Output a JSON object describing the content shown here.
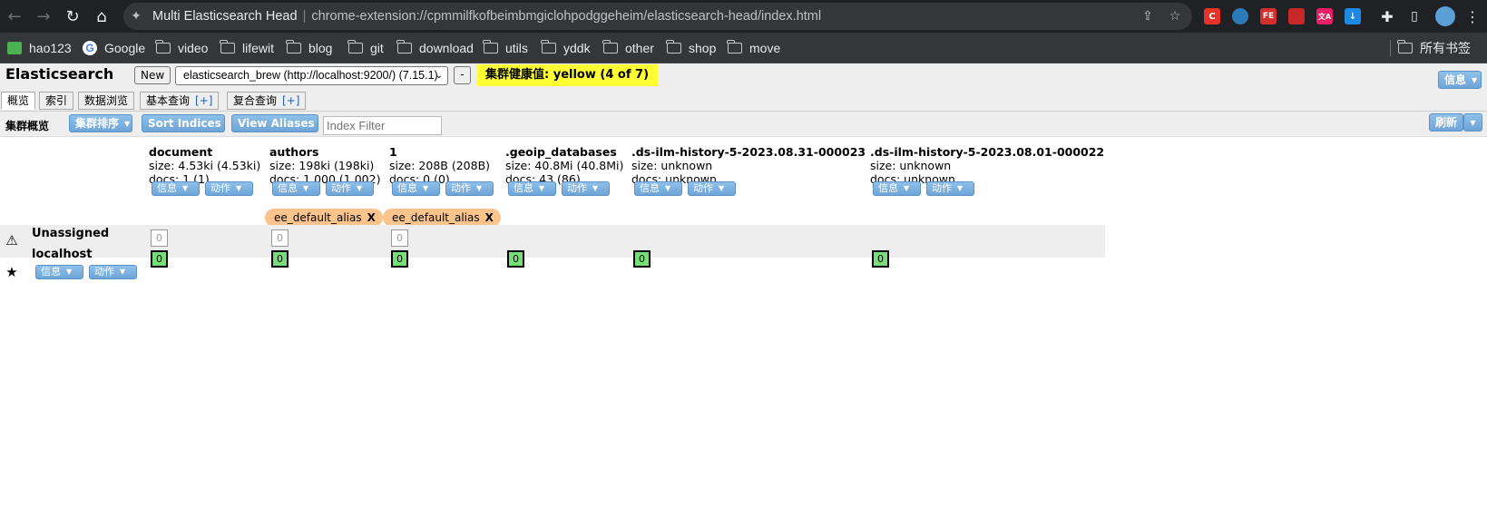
{
  "browser": {
    "tab_title": "Multi Elasticsearch Head",
    "url": "chrome-extension://cpmmilfkofbeimbmgiclohpodggeheim/elasticsearch-head/index.html",
    "extensions": [
      {
        "name": "c-extension-icon",
        "label": "C",
        "color": "#e5332a"
      },
      {
        "name": "globe-extension-icon",
        "label": "●",
        "color": "#2b7bb9"
      },
      {
        "name": "fe-extension-icon",
        "label": "FE",
        "color": "#d32f2f"
      },
      {
        "name": "cube-extension-icon",
        "label": "■",
        "color": "#c62828"
      },
      {
        "name": "translate-extension-icon",
        "label": "文A",
        "color": "#e91e63"
      },
      {
        "name": "download-extension-icon",
        "label": "↓",
        "color": "#1e88e5"
      }
    ]
  },
  "bookmarks": {
    "items": [
      "hao123",
      "Google",
      "video",
      "lifewit",
      "blog",
      "git",
      "download",
      "utils",
      "yddk",
      "other",
      "shop",
      "move"
    ],
    "all_bookmarks": "所有书签"
  },
  "header": {
    "title": "Elasticsearch",
    "new_label": "New",
    "cluster_selected": "elasticsearch_brew (http://localhost:9200/) (7.15.1)",
    "minus_label": "-",
    "health": "集群健康值: yellow (4 of 7)",
    "health_color": "#ffff33",
    "info_label": "信息"
  },
  "tabs": [
    {
      "label": "概览",
      "active": true
    },
    {
      "label": "索引",
      "active": false
    },
    {
      "label": "数据浏览",
      "active": false
    },
    {
      "label": "基本查询",
      "plus": "[+]"
    },
    {
      "label": "复合查询",
      "plus": "[+]"
    }
  ],
  "toolbar": {
    "label": "集群概览",
    "cluster_sort": "集群排序",
    "sort_indices": "Sort Indices",
    "view_aliases": "View Aliases",
    "filter_placeholder": "Index Filter",
    "refresh": "刷新"
  },
  "buttons": {
    "info": "信息",
    "action": "动作"
  },
  "indices": [
    {
      "name": "document",
      "size": "size: 4.53ki (4.53ki)",
      "docs": "docs: 1 (1)"
    },
    {
      "name": "authors",
      "size": "size: 198ki (198ki)",
      "docs": "docs: 1,000 (1,002)"
    },
    {
      "name": "1",
      "size": "size: 208B (208B)",
      "docs": "docs: 0 (0)"
    },
    {
      "name": ".geoip_databases",
      "size": "size: 40.8Mi (40.8Mi)",
      "docs": "docs: 43 (86)"
    },
    {
      "name": ".ds-ilm-history-5-2023.08.31-000023",
      "size": "size: unknown",
      "docs": "docs: unknown"
    },
    {
      "name": ".ds-ilm-history-5-2023.08.01-000022",
      "size": "size: unknown",
      "docs": "docs: unknown"
    }
  ],
  "aliases": [
    {
      "label": "ee_default_alias",
      "close": "X"
    },
    {
      "label": "ee_default_alias",
      "close": "X"
    }
  ],
  "rows": {
    "unassigned": {
      "label": "Unassigned",
      "shards": [
        "0",
        "0",
        "0"
      ]
    },
    "node": {
      "label": "localhost",
      "shards": [
        "0",
        "0",
        "0",
        "0",
        "0",
        "0"
      ]
    }
  },
  "colors": {
    "shard_started": "#77dd77",
    "alias_bg": "#fbc48c",
    "button_blue": "#6ea4d8"
  }
}
